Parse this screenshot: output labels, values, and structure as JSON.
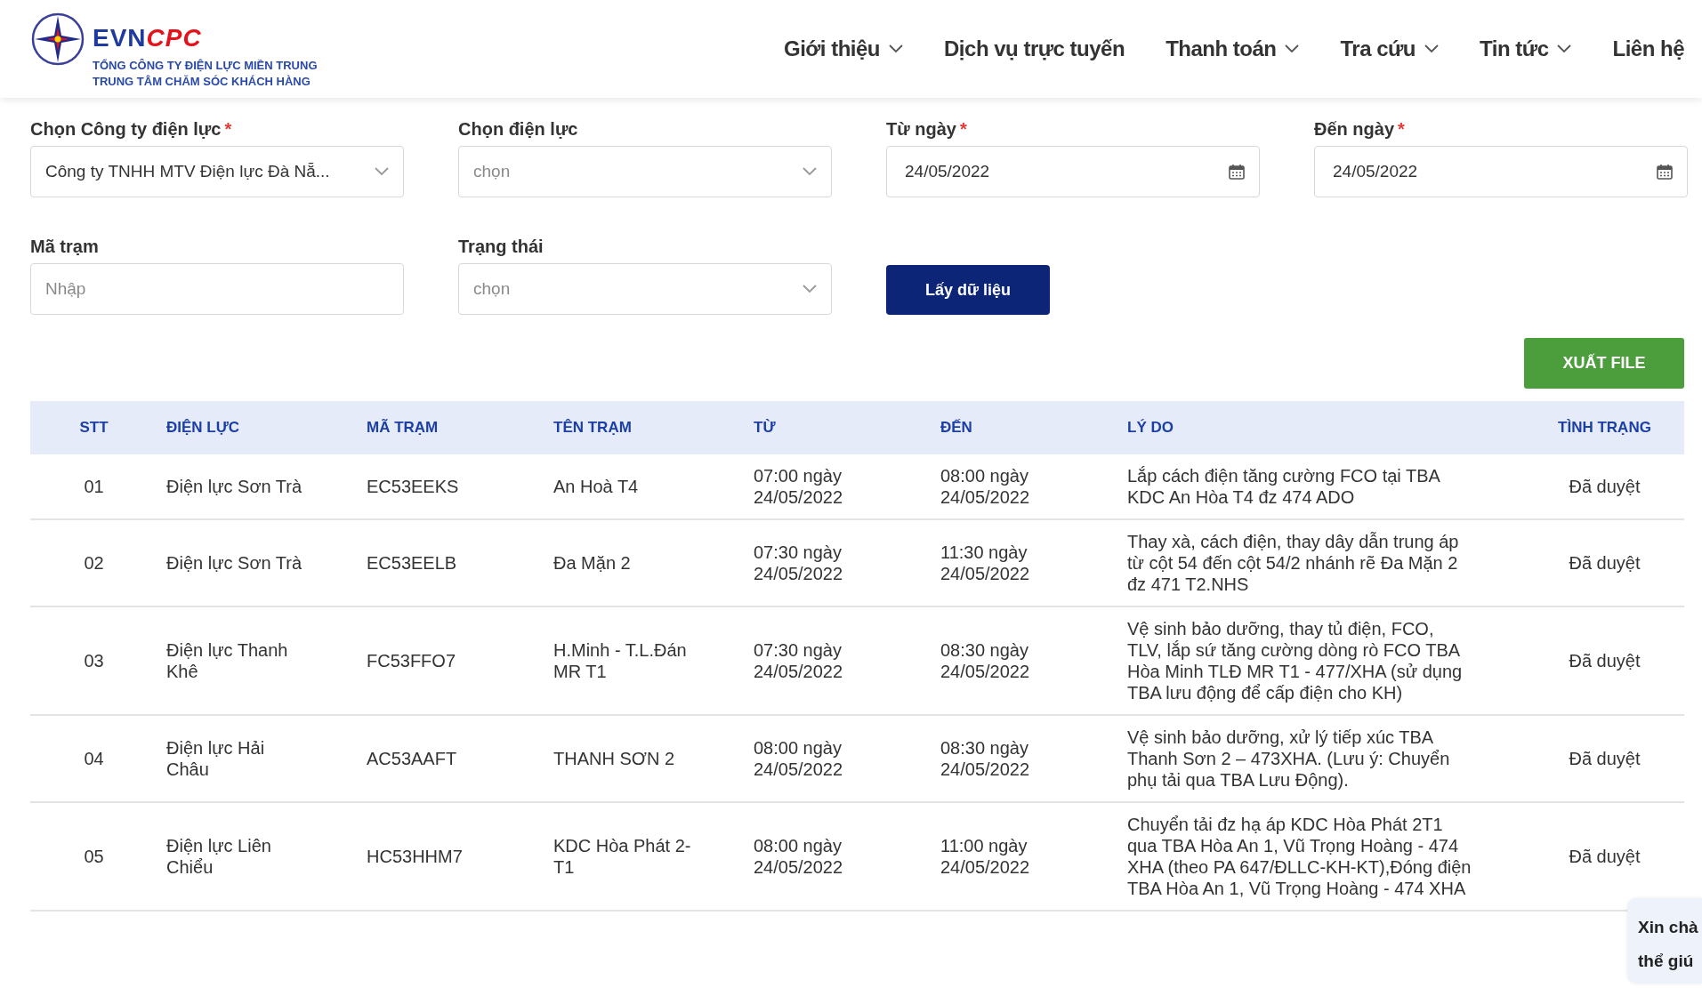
{
  "header": {
    "logo": {
      "brand_part1": "EVN",
      "brand_part2": "CPC",
      "lines": [
        "TỔNG CÔNG TY ĐIỆN LỰC MIỀN TRUNG",
        "TRUNG TÂM CHĂM SÓC KHÁCH HÀNG"
      ]
    },
    "nav": [
      {
        "label": "Giới thiệu",
        "has_menu": true
      },
      {
        "label": "Dịch vụ trực tuyến",
        "has_menu": false
      },
      {
        "label": "Thanh toán",
        "has_menu": true
      },
      {
        "label": "Tra cứu",
        "has_menu": true
      },
      {
        "label": "Tin tức",
        "has_menu": true
      },
      {
        "label": "Liên hệ",
        "has_menu": false
      }
    ]
  },
  "filters": [
    {
      "kind": "select",
      "label": "Chọn Công ty điện lực",
      "required_mark": "*",
      "value": "Công ty TNHH MTV Điện lực Đà Nẵ..."
    },
    {
      "kind": "select",
      "label": "Chọn điện lực",
      "placeholder": "chọn"
    },
    {
      "kind": "date",
      "label": "Từ ngày",
      "required_mark": "*",
      "value": "24/05/2022"
    },
    {
      "kind": "date",
      "label": "Đến ngày",
      "required_mark": "*",
      "value": "24/05/2022"
    },
    {
      "kind": "text",
      "label": "Mã trạm",
      "placeholder": "Nhập"
    },
    {
      "kind": "select",
      "label": "Trạng thái",
      "placeholder": "chọn"
    },
    {
      "kind": "button",
      "label": "Lấy dữ liệu"
    }
  ],
  "export_button": "XUẤT FILE",
  "table": {
    "columns": [
      "STT",
      "ĐIỆN LỰC",
      "MÃ TRẠM",
      "TÊN TRẠM",
      "TỪ",
      "ĐẾN",
      "LÝ DO",
      "TÌNH TRẠNG"
    ],
    "rows": [
      [
        "01",
        "Điện lực Sơn Trà",
        "EC53EEKS",
        "An Hoà T4",
        "07:00 ngày 24/05/2022",
        "08:00 ngày 24/05/2022",
        "Lắp cách điện tăng cường FCO tại TBA KDC An Hòa T4 đz 474 ADO",
        "Đã duyệt"
      ],
      [
        "02",
        "Điện lực Sơn Trà",
        "EC53EELB",
        "Đa Mặn 2",
        "07:30 ngày 24/05/2022",
        "11:30 ngày 24/05/2022",
        "Thay xà, cách điện, thay dây dẫn trung áp từ cột 54 đến cột 54/2 nhánh rẽ Đa Mặn 2 đz 471 T2.NHS",
        "Đã duyệt"
      ],
      [
        "03",
        "Điện lực Thanh Khê",
        "FC53FFO7",
        "H.Minh - T.L.Đán MR T1",
        "07:30 ngày 24/05/2022",
        "08:30 ngày 24/05/2022",
        "Vệ sinh bảo dưỡng, thay tủ điện, FCO, TLV, lắp sứ tăng cường dòng rò FCO TBA Hòa Minh TLĐ MR T1 - 477/XHA (sử dụng TBA lưu động để cấp điện cho KH)",
        "Đã duyệt"
      ],
      [
        "04",
        "Điện lực Hải Châu",
        "AC53AAFT",
        "THANH SƠN 2",
        "08:00 ngày 24/05/2022",
        "08:30 ngày 24/05/2022",
        "Vệ sinh bảo dưỡng, xử lý tiếp xúc TBA Thanh Sơn 2 – 473XHA. (Lưu ý: Chuyển phụ tải qua TBA Lưu Động).",
        "Đã duyệt"
      ],
      [
        "05",
        "Điện lực Liên Chiểu",
        "HC53HHM7",
        "KDC Hòa Phát 2-T1",
        "08:00 ngày 24/05/2022",
        "11:00 ngày 24/05/2022",
        "Chuyển tải đz hạ áp KDC Hòa Phát 2T1 qua TBA Hòa An 1, Vũ Trọng Hoàng - 474 XHA (theo PA 647/ĐLLC-KH-KT),Đóng điện TBA Hòa An 1, Vũ Trọng Hoàng - 474 XHA",
        "Đã duyệt"
      ]
    ]
  },
  "chat_bubble": {
    "lines": [
      "Xin chà",
      "thể giú"
    ]
  }
}
